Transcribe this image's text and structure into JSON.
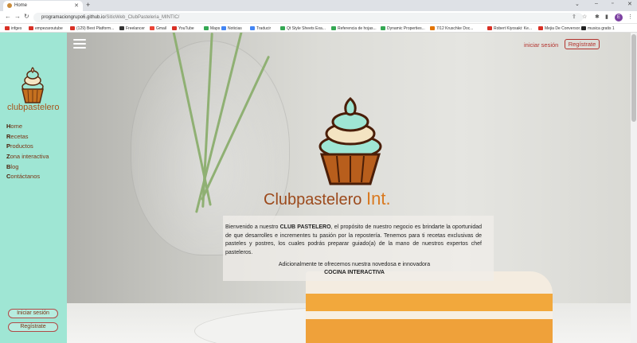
{
  "browser": {
    "tab_title": "Home",
    "url_host": "programaciongrupo6.github.io",
    "url_path": "/SitioWeb_ClubPasteleria_MINTIC/",
    "profile_initial": "E",
    "bookmarks": [
      {
        "label": "infges",
        "color": "#d93025"
      },
      {
        "label": "empezaroutube",
        "color": "#d93025"
      },
      {
        "label": "(129) Best Platform...",
        "color": "#d93025"
      },
      {
        "label": "Freelancer",
        "color": "#333333"
      },
      {
        "label": "Gmail",
        "color": "#ea4335"
      },
      {
        "label": "YouTube",
        "color": "#d93025"
      },
      {
        "label": "Maps",
        "color": "#34a853"
      },
      {
        "label": "Noticias",
        "color": "#4285f4"
      },
      {
        "label": "Traducir",
        "color": "#4285f4"
      },
      {
        "label": "Qt Style Sheets Exa...",
        "color": "#34a853"
      },
      {
        "label": "Referencia de hojas...",
        "color": "#34a853"
      },
      {
        "label": "Dynamic Properties...",
        "color": "#34a853"
      },
      {
        "label": "7/12 Kruschke Doc...",
        "color": "#e37400"
      },
      {
        "label": "Robert Kiyosaki: Ke...",
        "color": "#d93025"
      },
      {
        "label": "Mejia De Conversor...",
        "color": "#d93025"
      },
      {
        "label": "musica gratis 1",
        "color": "#222222"
      }
    ]
  },
  "sidebar": {
    "brand": "clubpastelero",
    "menu": [
      {
        "first": "H",
        "rest": "ome"
      },
      {
        "first": "R",
        "rest": "ecetas"
      },
      {
        "first": "P",
        "rest": "roductos"
      },
      {
        "first": "Z",
        "rest": "ona interactiva"
      },
      {
        "first": "B",
        "rest": "log"
      },
      {
        "first": "C",
        "rest": "ontáctanos"
      }
    ],
    "login_label": "Iniciar sesión",
    "register_label": "Regístrate"
  },
  "header": {
    "login_label": "iniciar sesión",
    "register_label": "Regístrate"
  },
  "hero": {
    "title_main": "Clubpastelero",
    "title_suffix": "Int.",
    "intro_before": "Bienvenido a nuestro ",
    "intro_bold": "CLUB PASTELERO",
    "intro_after": ", el propósito de nuestro negocio es brindarte la oportunidad de que desarrolles e incrementes tu pasión por la repostería. Tenemos para ti recetas exclusivas de pasteles y postres, los cuales podrás preparar guiado(a) de la mano de nuestros expertos chef pasteleros.",
    "offer_line": "Adicionalmente te ofrecemos nuestra novedosa e innovadora",
    "offer_bold": "COCINA INTERACTIVA"
  },
  "colors": {
    "sidebar_bg": "#9fe6d4",
    "accent_red": "#b3332e",
    "brand_brown": "#9c4a1c",
    "brand_orange": "#d9791f"
  }
}
